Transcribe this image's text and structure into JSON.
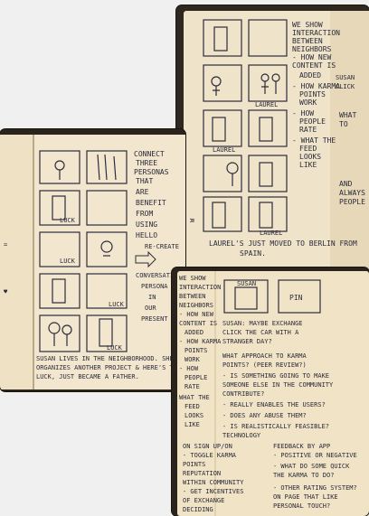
{
  "photos": {
    "top_right": {
      "left_notes": [
        "WE SHOW",
        "INTERACTION",
        "BETWEEN",
        "NEIGHBORS",
        "- HOW NEW",
        "CONTENT IS",
        "ADDED",
        "- HOW KARMA",
        "POINTS",
        "WORK",
        "- HOW",
        "PEOPLE",
        "RATE",
        "- WHAT THE",
        "FEED",
        "LOOKS",
        "LIKE"
      ],
      "caption": "LAUREL'S JUST MOVED TO BERLIN FROM SPAIN.",
      "labels": [
        "LAUREL",
        "LAUREL",
        "LAUREL",
        "SUSAN",
        "CLICK"
      ],
      "edge_notes": [
        "WHAT",
        "TO",
        "AND",
        "ALWAYS",
        "PEOPLE",
        "W"
      ]
    },
    "left": {
      "side_notes": [
        "CONNECT",
        "THREE",
        "PERSONAS",
        "THAT",
        "ARE",
        "BENEFIT",
        "FROM",
        "USING",
        "HELLO"
      ],
      "arrow_notes": [
        "RE-CREATE",
        "CONVERSATIONS",
        "PERSONA",
        "IN",
        "OUR",
        "PRESENT"
      ],
      "labels": [
        "LUCK",
        "LUCK",
        "LUCK",
        "LUCK"
      ],
      "caption": "SUSAN LIVES IN THE NEIGHBORHOOD. SHE ORGANIZES ANOTHER PROJECT & HERE'S TO LUCK, JUST BECAME A FATHER."
    },
    "bottom_right": {
      "left_notes": [
        "WE SHOW",
        "INTERACTION",
        "BETWEEN",
        "NEIGHBORS",
        "- HOW NEW",
        "CONTENT IS",
        "ADDED",
        "- HOW KARMA",
        "POINTS",
        "WORK",
        "- HOW",
        "PEOPLE",
        "RATE",
        "WHAT THE",
        "FEED",
        "LOOKS",
        "LIKE"
      ],
      "tag_left": "SUSAN",
      "tag_right": "PIN",
      "lines": [
        "SUSAN: MAYBE EXCHANGE",
        "CLICK   THE CAR WITH A",
        "        STRANGER DAY?",
        "WHAT APPROACH TO KARMA",
        "POINTS? (PEER REVIEW?)",
        "- IS SOMETHING GOING TO MAKE",
        "  SOMEONE ELSE IN THE COMMUNITY",
        "  CONTRIBUTE?",
        "- REALLY ENABLES THE USERS?",
        "- DOES ANY ABUSE THEM?",
        "- IS REALISTICALLY FEASIBLE?",
        "  TECHNOLOGY"
      ],
      "col_left": [
        "ON SIGN UP/ON",
        "- TOGGLE KARMA",
        "  POINTS",
        "  REPUTATION",
        "  WITHIN COMMUNITY",
        "- GET INCENTIVES",
        "  OF EXCHANGE",
        "  DECIDING"
      ],
      "col_right": [
        "FEEDBACK BY APP",
        "- POSITIVE OR NEGATIVE",
        "- WHAT DO SOME QUICK",
        "  THE KARMA TO DO?",
        "- OTHER RATING SYSTEM?",
        "  ON PAGE THAT LIKE",
        "  PERSONAL TOUCH?"
      ]
    }
  }
}
